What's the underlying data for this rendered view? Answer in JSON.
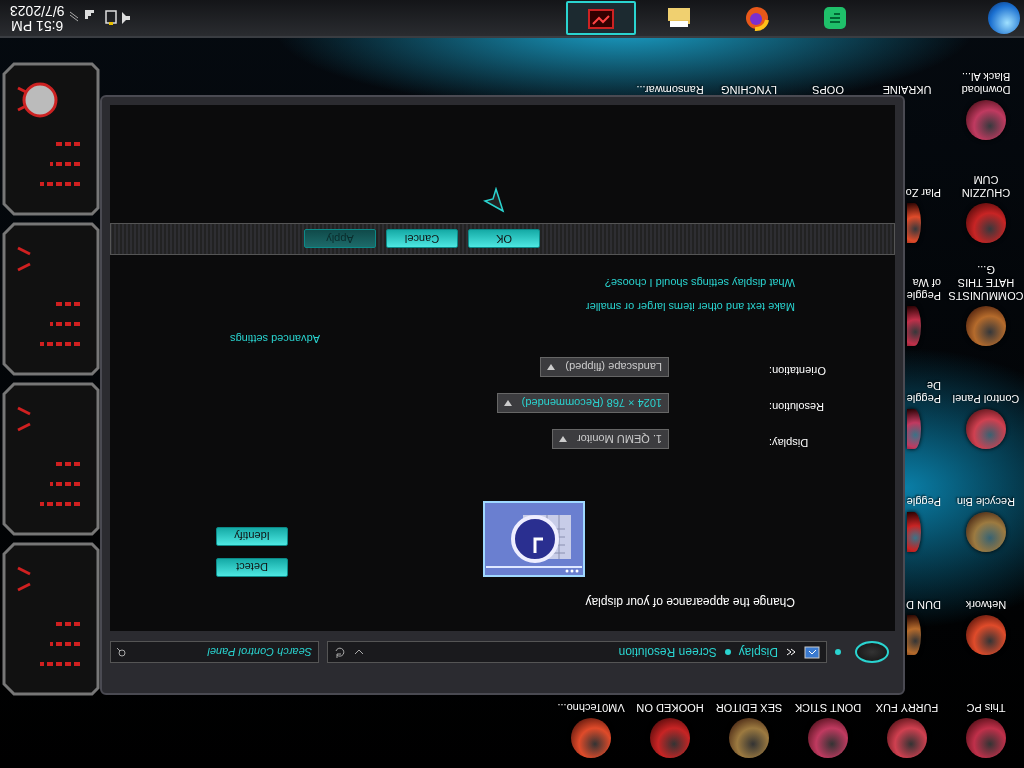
{
  "desktop": {
    "columns": [
      {
        "items": [
          {
            "label": "This PC"
          },
          {
            "label": "Network"
          },
          {
            "label": "Recycle Bin"
          },
          {
            "label": "Control Panel"
          },
          {
            "label": "COMMUNISTS HATE THIS G..."
          },
          {
            "label": "CHUZZIN CUM"
          },
          {
            "label": "Download Black Al..."
          }
        ]
      },
      {
        "items": [
          {
            "label": "FURRY FUX"
          },
          {
            "label": "DUN D"
          },
          {
            "label": "Peggle"
          },
          {
            "label": "Peggle De"
          },
          {
            "label": "Peggle of Wa"
          },
          {
            "label": "Plar Zo"
          },
          {
            "label": "UKRAINE"
          }
        ]
      },
      {
        "items": [
          {
            "label": "DONT STICK"
          },
          {
            "label": "OOPS"
          }
        ]
      },
      {
        "items": [
          {
            "label": "SEX EDITOR"
          },
          {
            "label": "LYNCHING"
          }
        ]
      },
      {
        "items": [
          {
            "label": "HOOKED ON"
          },
          {
            "label": "Ransomwar..."
          }
        ]
      },
      {
        "items": [
          {
            "label": "VM0Techno..."
          }
        ]
      }
    ]
  },
  "window": {
    "address_bar": {
      "breadcrumbs": [
        "Display",
        "Screen Resolution"
      ],
      "search_placeholder": "Search Control Panel"
    },
    "heading": "Change the appearance of your display",
    "buttons_side": [
      "Detect",
      "Identify"
    ],
    "fields": [
      {
        "label": "Display:",
        "value": "1. QEMU Monitor",
        "focused": false
      },
      {
        "label": "Resolution:",
        "value": "1024 × 768 (Recommended)",
        "focused": true
      },
      {
        "label": "Orientation:",
        "value": "Landscape (flipped)",
        "focused": false
      }
    ],
    "advanced_link": "Advanced settings",
    "links": [
      "Make text and other items larger or smaller",
      "What display settings should I choose?"
    ],
    "buttons": [
      {
        "label": "OK",
        "disabled": false
      },
      {
        "label": "Cancel",
        "disabled": false
      },
      {
        "label": "Apply",
        "disabled": true
      }
    ]
  },
  "taskbar": {
    "apps": [
      {
        "kind": "notes",
        "selected": false
      },
      {
        "kind": "browser",
        "selected": false
      },
      {
        "kind": "folder",
        "selected": false
      },
      {
        "kind": "display",
        "selected": true
      }
    ],
    "time": "6:51 PM",
    "date": "9/7/2023"
  }
}
